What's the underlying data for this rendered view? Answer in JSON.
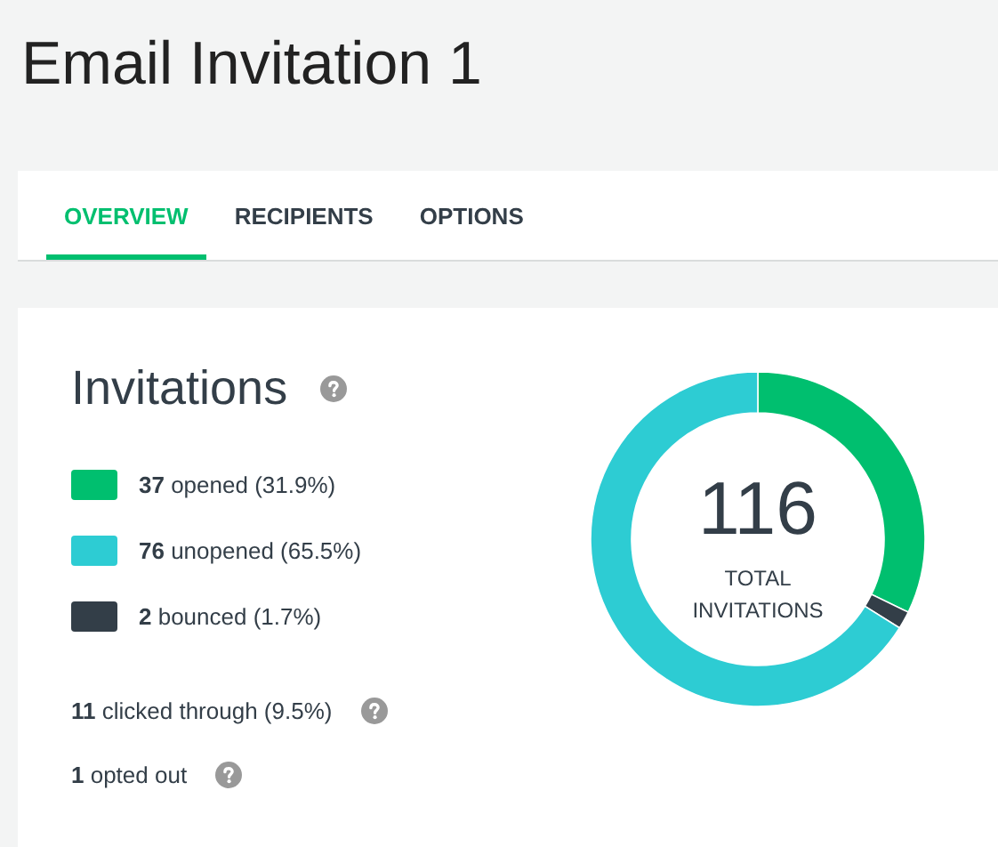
{
  "title": "Email Invitation 1",
  "tabs": [
    {
      "label": "OVERVIEW",
      "selected": true
    },
    {
      "label": "RECIPIENTS",
      "selected": false
    },
    {
      "label": "OPTIONS",
      "selected": false
    }
  ],
  "card": {
    "heading": "Invitations",
    "legend": [
      {
        "color": "#00bf6f"
      },
      {
        "color": "#2dccd3"
      },
      {
        "color": "#333e48"
      }
    ],
    "stats": [
      {
        "text": "**11** clicked through (9.5%)"
      },
      {
        "text": "**1** opted out"
      }
    ],
    "chart_data": {
      "type": "donut",
      "categories": [
        "**37** opened (31.9%)",
        "**76** unopened (65.5%)",
        "**2** bounced (1.7%)"
      ],
      "values": [
        31.9,
        65.5,
        1.7
      ]
    },
    "total": "116",
    "total_label": "TOTAL INVITATIONS"
  }
}
